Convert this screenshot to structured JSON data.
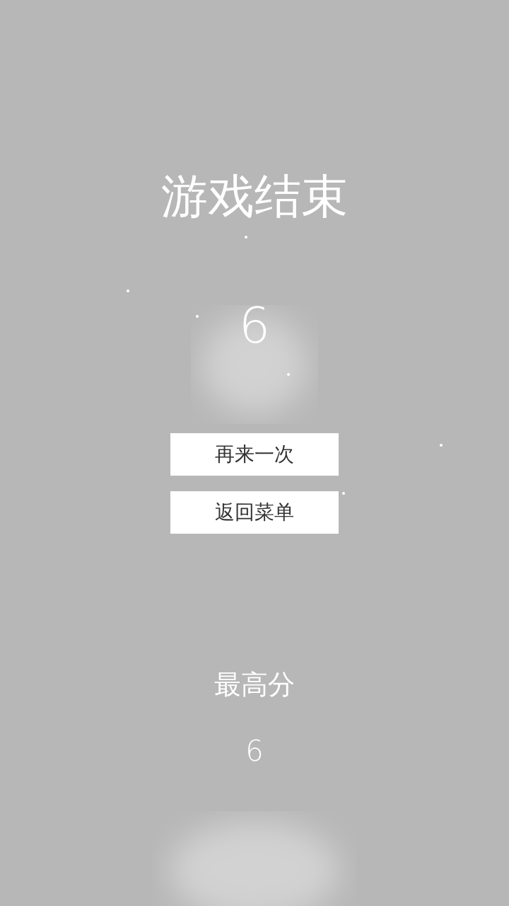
{
  "title": "游戏结束",
  "score": "6",
  "buttons": [
    {
      "label": "再来一次"
    },
    {
      "label": "返回菜单"
    }
  ],
  "best": {
    "label": "最高分",
    "value": "6"
  }
}
